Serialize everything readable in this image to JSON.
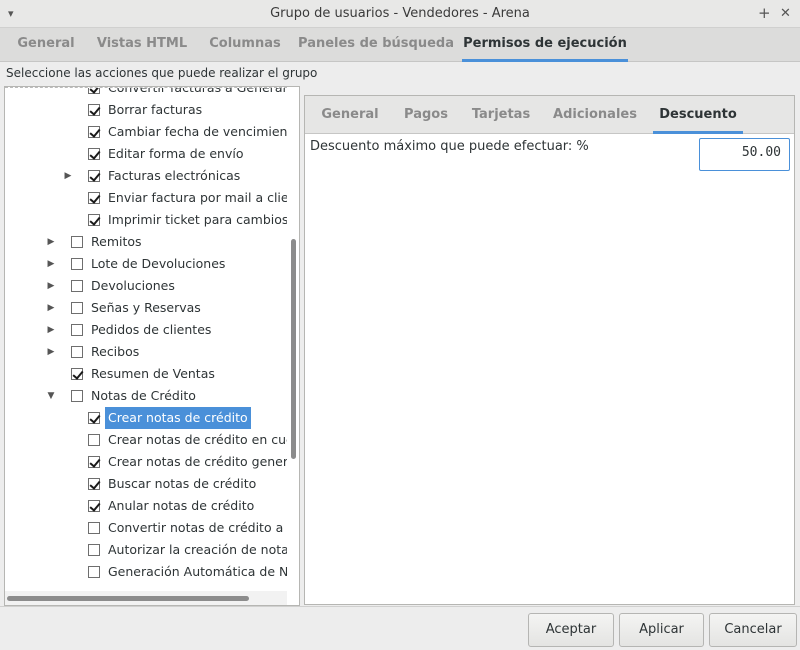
{
  "window": {
    "title": "Grupo de usuarios - Vendedores - Arena",
    "menu_glyph": "▾",
    "max_glyph": "+",
    "close_glyph": "✕"
  },
  "main_tabs": [
    {
      "label": "General"
    },
    {
      "label": "Vistas HTML"
    },
    {
      "label": "Columnas"
    },
    {
      "label": "Paneles de búsqueda"
    },
    {
      "label": "Permisos de ejecución",
      "active": true
    }
  ],
  "instructions": "Seleccione las acciones que puede realizar el grupo",
  "tree": [
    {
      "label": "Convertir facturas a General",
      "checked": true,
      "level": 2,
      "expander": "none"
    },
    {
      "label": "Borrar facturas",
      "checked": true,
      "level": 2,
      "expander": "none"
    },
    {
      "label": "Cambiar fecha de vencimiento d",
      "checked": true,
      "level": 2,
      "expander": "none"
    },
    {
      "label": "Editar forma de envío",
      "checked": true,
      "level": 2,
      "expander": "none"
    },
    {
      "label": "Facturas electrónicas",
      "checked": true,
      "level": 2,
      "expander": "collapsed"
    },
    {
      "label": "Enviar factura por mail a cliente",
      "checked": true,
      "level": 2,
      "expander": "none"
    },
    {
      "label": "Imprimir ticket para cambios (re",
      "checked": true,
      "level": 2,
      "expander": "none"
    },
    {
      "label": "Remitos",
      "checked": false,
      "level": 1,
      "expander": "collapsed"
    },
    {
      "label": "Lote de Devoluciones",
      "checked": false,
      "level": 1,
      "expander": "collapsed"
    },
    {
      "label": "Devoluciones",
      "checked": false,
      "level": 1,
      "expander": "collapsed"
    },
    {
      "label": "Señas y Reservas",
      "checked": false,
      "level": 1,
      "expander": "collapsed"
    },
    {
      "label": "Pedidos de clientes",
      "checked": false,
      "level": 1,
      "expander": "collapsed"
    },
    {
      "label": "Recibos",
      "checked": false,
      "level": 1,
      "expander": "collapsed"
    },
    {
      "label": "Resumen de Ventas",
      "checked": true,
      "level": 1,
      "expander": "none"
    },
    {
      "label": "Notas de Crédito",
      "checked": false,
      "level": 1,
      "expander": "expanded"
    },
    {
      "label": "Crear notas de crédito",
      "checked": true,
      "level": 2,
      "expander": "none",
      "selected": true
    },
    {
      "label": "Crear notas de crédito en cuent",
      "checked": false,
      "level": 2,
      "expander": "none"
    },
    {
      "label": "Crear notas de crédito generale",
      "checked": true,
      "level": 2,
      "expander": "none"
    },
    {
      "label": "Buscar notas de crédito",
      "checked": true,
      "level": 2,
      "expander": "none"
    },
    {
      "label": "Anular notas de crédito",
      "checked": true,
      "level": 2,
      "expander": "none"
    },
    {
      "label": "Convertir notas de crédito a Ge",
      "checked": false,
      "level": 2,
      "expander": "none"
    },
    {
      "label": "Autorizar la creación de notas d",
      "checked": false,
      "level": 2,
      "expander": "none"
    },
    {
      "label": "Generación Automática de Nota",
      "checked": false,
      "level": 2,
      "expander": "none"
    }
  ],
  "sub_tabs": [
    {
      "label": "General"
    },
    {
      "label": "Pagos"
    },
    {
      "label": "Tarjetas"
    },
    {
      "label": "Adicionales"
    },
    {
      "label": "Descuento",
      "active": true
    }
  ],
  "discount": {
    "label": "Descuento máximo que puede efectuar: %",
    "value": "50.00"
  },
  "buttons": {
    "accept": "Aceptar",
    "apply": "Aplicar",
    "cancel": "Cancelar"
  },
  "colors": {
    "accent": "#4a90d9",
    "selection": "#4a90d9"
  }
}
